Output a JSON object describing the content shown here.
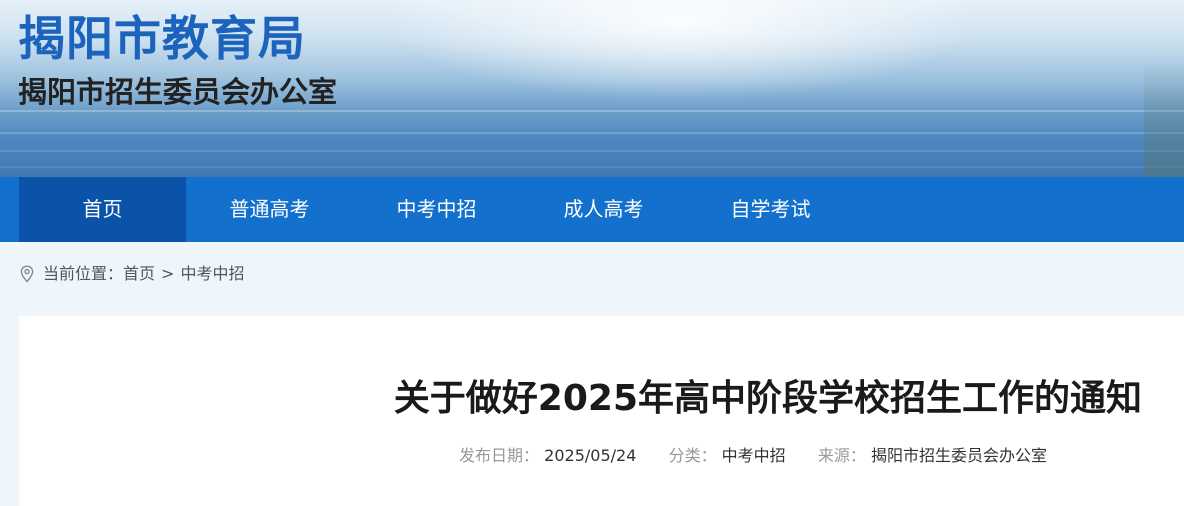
{
  "header": {
    "title": "揭阳市教育局",
    "subtitle": "揭阳市招生委员会办公室"
  },
  "nav": {
    "items": [
      {
        "label": "首页",
        "active": true
      },
      {
        "label": "普通高考",
        "active": false
      },
      {
        "label": "中考中招",
        "active": false
      },
      {
        "label": "成人高考",
        "active": false
      },
      {
        "label": "自学考试",
        "active": false
      }
    ]
  },
  "breadcrumb": {
    "prefix": "当前位置：",
    "items": [
      "首页",
      "中考中招"
    ],
    "separator": ">"
  },
  "article": {
    "title": "关于做好2025年高中阶段学校招生工作的通知",
    "meta": {
      "date_label": "发布日期：",
      "date": "2025/05/24",
      "category_label": "分类：",
      "category": "中考中招",
      "source_label": "来源：",
      "source": "揭阳市招生委员会办公室"
    }
  },
  "colors": {
    "nav_bg": "#1370cd",
    "nav_active_bg": "#0a53a8",
    "title_blue": "#1b63bd"
  },
  "icons": {
    "location": "location-pin-icon"
  }
}
